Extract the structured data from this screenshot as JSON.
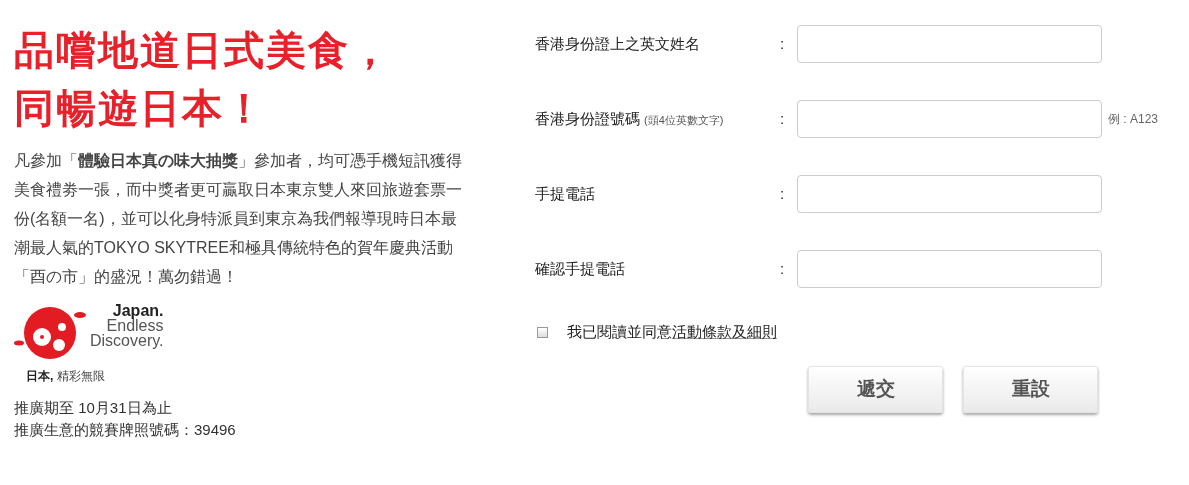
{
  "headline": [
    "品嚐地道日式美食，",
    "同暢遊日本！"
  ],
  "intro": "凡參加「**體驗日本真の味大抽獎**」參加者，均可憑手機短訊獲得美食禮劵一張，而中獎者更可贏取日本東京雙人來回旅遊套票一份(名額一名)，並可以化身特派員到東京為我們報導現時日本最潮最人氣的TOKYO SKYTREE和極具傳統特色的賀年慶典活動「酉の市」的盛況！萬勿錯過！",
  "logo": {
    "lines": [
      "Japan.",
      "Endless",
      "Discovery."
    ],
    "tagline_bold": "日本,",
    "tagline": "精彩無限"
  },
  "footer": [
    "推廣期至 10月31日為止",
    "推廣生意的競賽牌照號碼：39496"
  ],
  "form": {
    "fields": [
      {
        "label": "香港身份證上之英文姓名",
        "colon": ":"
      },
      {
        "label": "香港身份證號碼",
        "hint": "(頭4位英數文字)",
        "colon": ":",
        "example": "例 : A123"
      },
      {
        "label": "手提電話",
        "colon": ":"
      },
      {
        "label": "確認手提電話",
        "colon": ":"
      }
    ],
    "agree": {
      "checked": false,
      "text": "我已閱讀並同意",
      "link": "活動條款及細則"
    },
    "buttons": [
      "遞交",
      "重設"
    ]
  }
}
